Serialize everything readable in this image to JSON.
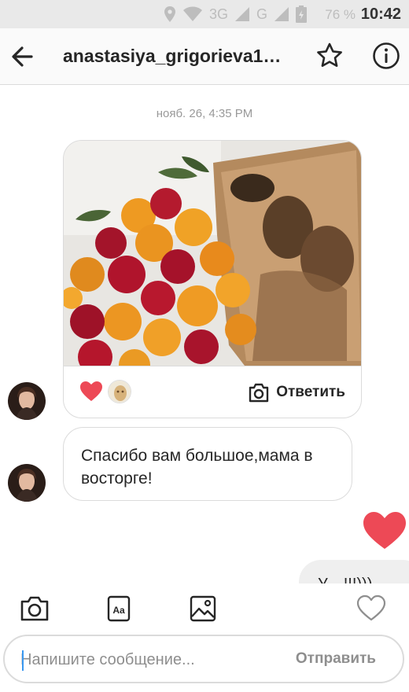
{
  "status_bar": {
    "network_3g": "3G",
    "network_g": "G",
    "battery": "76 %",
    "time": "10:42"
  },
  "header": {
    "title": "anastasiya_grigorieva1…"
  },
  "thread": {
    "timestamp": "нояб. 26, 4:35 PM",
    "shared_post": {
      "reply_label": "Ответить"
    },
    "incoming_message": "Спасибо вам большое,мама в восторге!",
    "outgoing_message": "У…!!!)))"
  },
  "composer": {
    "placeholder": "Напишите сообщение...",
    "send_label": "Отправить"
  },
  "colors": {
    "accent_blue": "#3897f0",
    "heart_red": "#ed4956",
    "border": "#dbdbdb",
    "muted_text": "#8e8e8e"
  },
  "icons": [
    "location-icon",
    "wifi-icon",
    "signal-icon",
    "battery-icon",
    "back-arrow-icon",
    "star-icon",
    "info-icon",
    "camera-icon",
    "text-format-icon",
    "gallery-icon",
    "heart-outline-icon"
  ]
}
